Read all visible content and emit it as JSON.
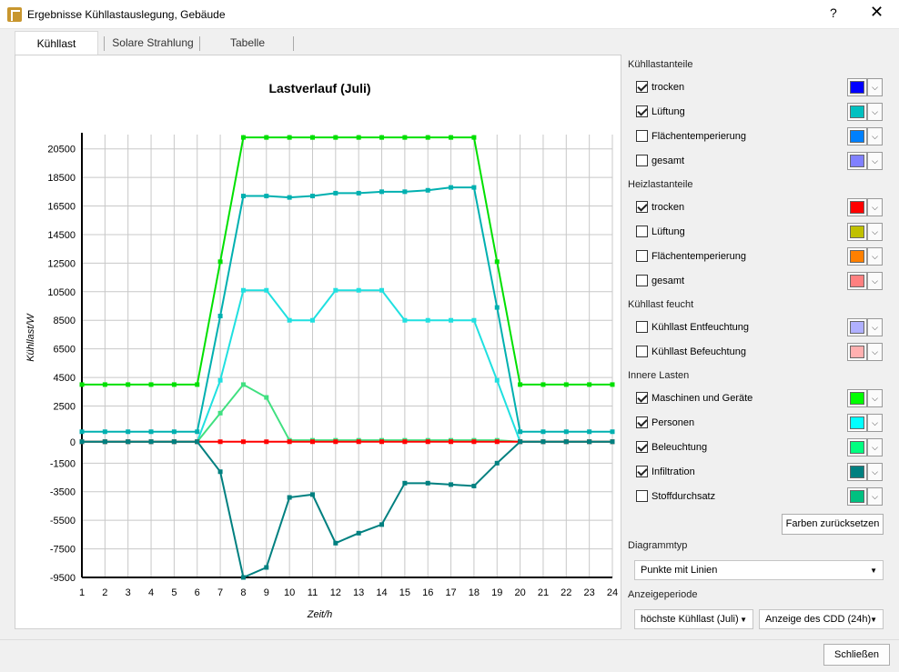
{
  "window": {
    "title": "Ergebnisse Kühllastauslegung, Gebäude",
    "help": "?",
    "close": "✕"
  },
  "tabs": [
    {
      "label": "Kühllast"
    },
    {
      "label": "Solare Strahlung"
    },
    {
      "label": "Tabelle"
    }
  ],
  "sections": [
    {
      "title": "Kühllastanteile",
      "items": [
        {
          "label": "trocken",
          "checked": true,
          "color": "#0000ff"
        },
        {
          "label": "Lüftung",
          "checked": true,
          "color": "#00c0c0"
        },
        {
          "label": "Flächentemperierung",
          "checked": false,
          "color": "#0080ff"
        },
        {
          "label": "gesamt",
          "checked": false,
          "color": "#8080ff"
        }
      ]
    },
    {
      "title": "Heizlastanteile",
      "items": [
        {
          "label": "trocken",
          "checked": true,
          "color": "#ff0000"
        },
        {
          "label": "Lüftung",
          "checked": false,
          "color": "#c0c000"
        },
        {
          "label": "Flächentemperierung",
          "checked": false,
          "color": "#ff8000"
        },
        {
          "label": "gesamt",
          "checked": false,
          "color": "#ff8080"
        }
      ]
    },
    {
      "title": "Kühllast feucht",
      "items": [
        {
          "label": "Kühllast Entfeuchtung",
          "checked": false,
          "color": "#b0b0ff"
        },
        {
          "label": "Kühllast Befeuchtung",
          "checked": false,
          "color": "#ffb0b0"
        }
      ]
    },
    {
      "title": "Innere Lasten",
      "items": [
        {
          "label": "Maschinen und Geräte",
          "checked": true,
          "color": "#00ff00"
        },
        {
          "label": "Personen",
          "checked": true,
          "color": "#00ffff"
        },
        {
          "label": "Beleuchtung",
          "checked": true,
          "color": "#00ff80"
        },
        {
          "label": "Infiltration",
          "checked": true,
          "color": "#008080"
        },
        {
          "label": "Stoffdurchsatz",
          "checked": false,
          "color": "#00c080"
        }
      ]
    }
  ],
  "reset_button": "Farben zurücksetzen",
  "diagramtyp": {
    "label": "Diagrammtyp",
    "value": "Punkte mit Linien"
  },
  "anzeige": {
    "label": "Anzeigeperiode",
    "period": "höchste Kühllast (Juli)",
    "cdd": "Anzeige des CDD (24h)"
  },
  "close_button": "Schließen",
  "chart_data": {
    "type": "line",
    "title": "Lastverlauf (Juli)",
    "xlabel": "Zeit/h",
    "ylabel": "Kühllast/W",
    "xlim": [
      1,
      24
    ],
    "ylim": [
      -9500,
      21500
    ],
    "yticks": [
      -9500,
      -7500,
      -5500,
      -3500,
      -1500,
      0,
      2500,
      4500,
      6500,
      8500,
      10500,
      12500,
      14500,
      16500,
      18500,
      20500
    ],
    "x": [
      1,
      2,
      3,
      4,
      5,
      6,
      7,
      8,
      9,
      10,
      11,
      12,
      13,
      14,
      15,
      16,
      17,
      18,
      19,
      20,
      21,
      22,
      23,
      24
    ],
    "grid": true,
    "series": [
      {
        "name": "Maschinen und Geräte",
        "color": "#00e000",
        "values": [
          4000,
          4000,
          4000,
          4000,
          4000,
          4000,
          12600,
          21300,
          21300,
          21300,
          21300,
          21300,
          21300,
          21300,
          21300,
          21300,
          21300,
          21300,
          12600,
          4000,
          4000,
          4000,
          4000,
          4000
        ]
      },
      {
        "name": "Lüftung",
        "color": "#00b0b0",
        "values": [
          700,
          700,
          700,
          700,
          700,
          700,
          8800,
          17200,
          17200,
          17100,
          17200,
          17400,
          17400,
          17500,
          17500,
          17600,
          17800,
          17800,
          9400,
          700,
          700,
          700,
          700,
          700
        ]
      },
      {
        "name": "Personen",
        "color": "#20e0e0",
        "values": [
          0,
          0,
          0,
          0,
          0,
          0,
          4300,
          10600,
          10600,
          8500,
          8500,
          10600,
          10600,
          10600,
          8500,
          8500,
          8500,
          8500,
          4300,
          0,
          0,
          0,
          0,
          0
        ]
      },
      {
        "name": "Beleuchtung",
        "color": "#40e080",
        "values": [
          0,
          0,
          0,
          0,
          0,
          0,
          2000,
          4000,
          3100,
          100,
          100,
          100,
          100,
          100,
          100,
          100,
          100,
          100,
          100,
          0,
          0,
          0,
          0,
          0
        ]
      },
      {
        "name": "trocken (Heizlast)",
        "color": "#ff0000",
        "values": [
          0,
          0,
          0,
          0,
          0,
          0,
          0,
          0,
          0,
          0,
          0,
          0,
          0,
          0,
          0,
          0,
          0,
          0,
          0,
          0,
          0,
          0,
          0,
          0
        ]
      },
      {
        "name": "Infiltration",
        "color": "#008080",
        "values": [
          0,
          0,
          0,
          0,
          0,
          0,
          -2100,
          -9500,
          -8800,
          -3900,
          -3700,
          -7100,
          -6400,
          -5800,
          -2900,
          -2900,
          -3000,
          -3100,
          -1500,
          0,
          0,
          0,
          0,
          0
        ]
      }
    ]
  }
}
